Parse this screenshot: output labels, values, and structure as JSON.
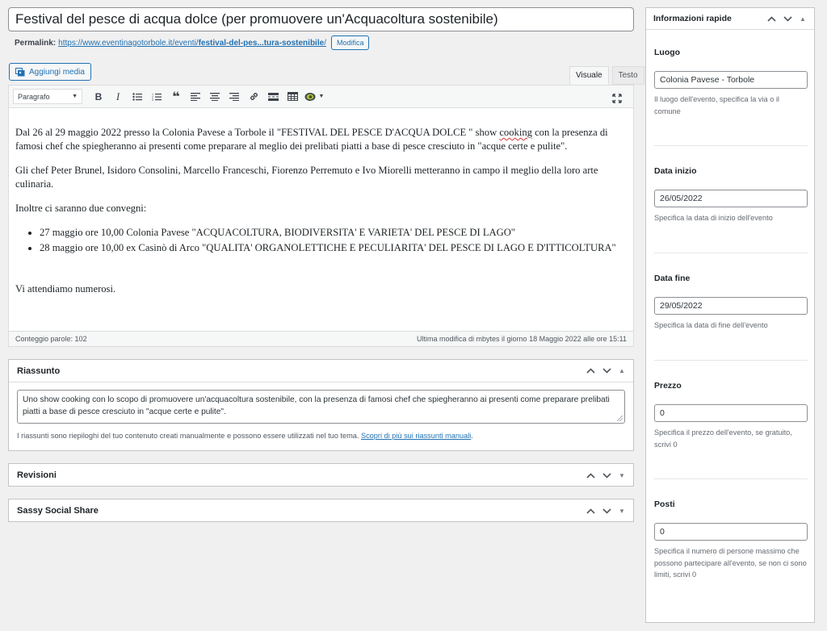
{
  "post": {
    "title": "Festival del pesce di acqua dolce (per promuovere un'Acquacoltura sostenibile)",
    "permalink_label": "Permalink:",
    "permalink_base": "https://www.eventinagotorbole.it/eventi/",
    "permalink_slug": "festival-del-pes...tura-sostenibile",
    "permalink_end": "/",
    "edit_label": "Modifica"
  },
  "editor": {
    "add_media_label": "Aggiungi media",
    "tabs": [
      "Visuale",
      "Testo"
    ],
    "format_select": "Paragrafo",
    "content": {
      "p1_before": "Dal 26 al 29 maggio 2022 presso la Colonia Pavese a Torbole  il \"FESTIVAL DEL PESCE D'ACQUA DOLCE \" show ",
      "p1_spell": "cooking",
      "p1_after": " con la presenza di famosi chef che spiegheranno ai presenti come preparare al meglio dei prelibati piatti a base di pesce cresciuto in \"acque certe e pulite\".",
      "p2": "Gli chef Peter Brunel, Isidoro Consolini, Marcello Franceschi, Fiorenzo Perremuto e Ivo Miorelli metteranno in campo il meglio della loro arte culinaria.",
      "p3": "Inoltre ci saranno due convegni:",
      "list": [
        "27 maggio ore 10,00 Colonia Pavese \"ACQUACOLTURA, BIODIVERSITA' E VARIETA' DEL PESCE DI LAGO\"",
        "28 maggio ore 10,00 ex Casinò di Arco \"QUALITA' ORGANOLETTICHE E PECULIARITA' DEL PESCE DI LAGO E D'ITTICOLTURA\""
      ],
      "p4": "Vi attendiamo numerosi."
    },
    "word_count": "Conteggio parole: 102",
    "last_modified": "Ultima modifica di mbytes il giorno 18 Maggio 2022 alle ore 15:11"
  },
  "excerpt": {
    "title": "Riassunto",
    "text": "Uno show cooking con lo scopo di promuovere un'acquacoltura sostenibile, con la presenza di famosi chef che spiegheranno ai presenti come preparare prelibati piatti a base di pesce cresciuto in \"acque certe e pulite\".",
    "help_text": "I riassunti sono riepiloghi del tuo contenuto creati manualmente e possono essere utilizzati nel tuo tema.",
    "help_link": "Scopri di più sui riassunti manuali",
    "help_end": "."
  },
  "revisions": {
    "title": "Revisioni"
  },
  "social": {
    "title": "Sassy Social Share"
  },
  "sidebar": {
    "title": "Informazioni rapide",
    "fields": [
      {
        "label": "Luogo",
        "value": "Colonia Pavese - Torbole",
        "desc": "Il luogo dell'evento, specifica la via o il comune"
      },
      {
        "label": "Data inizio",
        "value": "26/05/2022",
        "desc": "Specifica la data di inizio dell'evento"
      },
      {
        "label": "Data fine",
        "value": "29/05/2022",
        "desc": "Specifica la data di fine dell'evento"
      },
      {
        "label": "Prezzo",
        "value": "0",
        "desc": "Specifica il prezzo dell'evento, se gratuito, scrivi 0"
      },
      {
        "label": "Posti",
        "value": "0",
        "desc": "Specifica il numero di persone massimo che possono partecipare all'evento, se non ci sono limiti, scrivi 0"
      }
    ]
  },
  "icons": {
    "move_up": "chevron-up-icon",
    "move_down": "chevron-down-icon",
    "toggle": "triangle-icon"
  }
}
